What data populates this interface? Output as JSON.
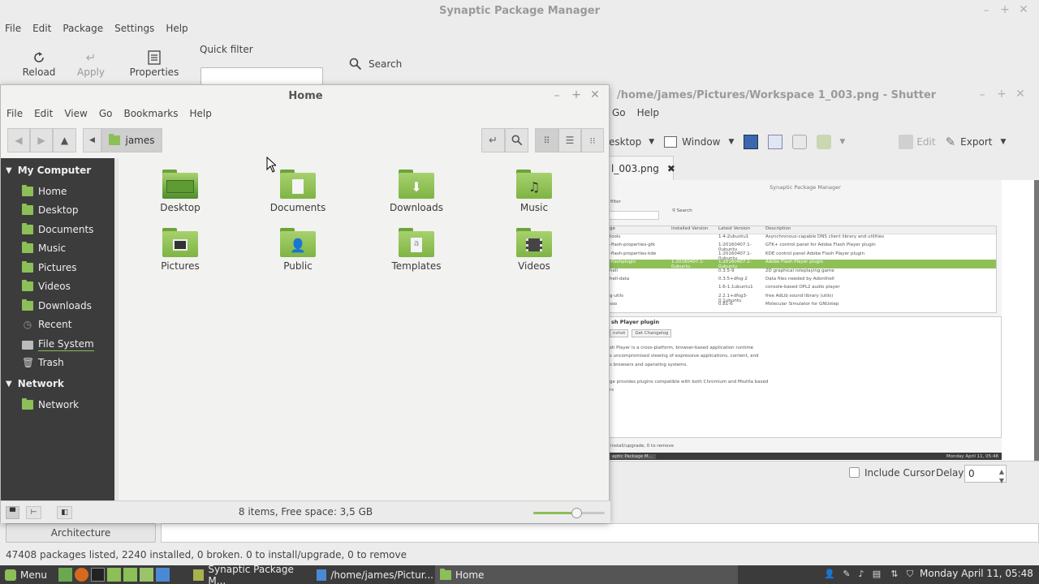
{
  "synaptic": {
    "title": "Synaptic Package Manager",
    "menu": [
      "File",
      "Edit",
      "Package",
      "Settings",
      "Help"
    ],
    "toolbar": {
      "reload": "Reload",
      "apply": "Apply",
      "properties": "Properties",
      "quick_filter": "Quick filter",
      "search": "Search"
    },
    "architecture_button": "Architecture",
    "status": "47408 packages listed, 2240 installed, 0 broken. 0 to install/upgrade, 0 to remove"
  },
  "shutter": {
    "title": "/home/james/Pictures/Workspace 1_003.png - Shutter",
    "menu": [
      "Go",
      "Help"
    ],
    "toolbar": {
      "desktop": "esktop",
      "window": "Window",
      "edit": "Edit",
      "export": "Export"
    },
    "tab_label": "l_003.png",
    "include_cursor": "Include Cursor",
    "delay_label": "Delay:",
    "delay_value": "0",
    "thumb": {
      "title": "Synaptic Package Manager",
      "filter": "filter",
      "search": "Search",
      "columns": [
        "ge",
        "Installed Version",
        "Latest Version",
        "Description"
      ],
      "rows": [
        [
          "tools",
          "",
          "1.4-2ubuntu1",
          "Asynchronous-capable DNS client library and utilities"
        ],
        [
          "-flash-properties-gtk",
          "",
          "1:20160407.1-0ubuntu",
          "GTK+ control panel for Adobe Flash Player plugin"
        ],
        [
          "-flash-properties-kde",
          "",
          "1:20160407.1-0ubuntu",
          "KDE control panel Adobe Flash Player plugin"
        ],
        [
          "-flashplugin",
          "1:20160407.1-0ubuntu",
          "1:20160407.1-0ubuntu",
          "Adobe Flash Player plugin"
        ],
        [
          "hell",
          "",
          "0.3.5-9",
          "2D graphical roleplaying game"
        ],
        [
          "hell-data",
          "",
          "0.3.5+dfsg-2",
          "Data files needed by Adonthell"
        ],
        [
          "",
          "",
          "1.6-1.1ubuntu1",
          "console-based OPL2 audio player"
        ],
        [
          "g-utils",
          "",
          "2.2.1+dfsg3-0.1ubuntu",
          "free AdLib sound library (utils)"
        ],
        [
          "sso",
          "",
          "0.81-6",
          "Molecular Simulator for GNUstep"
        ]
      ],
      "detail_title": "sh Player plugin",
      "detail_buttons": [
        "nshot",
        "Get Changelog"
      ],
      "detail_lines": [
        "sh Player is a cross-platform, browser-based application runtime",
        "s uncompromised viewing of expressive applications, content, and",
        "s browsers and operating systems.",
        "",
        "ge provides plugins compatible with both Chromium and Mozilla based",
        "rs"
      ],
      "status": "install/upgrade, 0 to remove",
      "taskbar_item": "aptic Package M...",
      "clock": "Monday April 11, 05:48"
    }
  },
  "nemo": {
    "title": "Home",
    "menu": [
      "File",
      "Edit",
      "View",
      "Go",
      "Bookmarks",
      "Help"
    ],
    "path_button": "james",
    "sidebar": {
      "my_computer": "My Computer",
      "items": [
        "Home",
        "Desktop",
        "Documents",
        "Music",
        "Pictures",
        "Videos",
        "Downloads",
        "Recent",
        "File System",
        "Trash"
      ],
      "network_header": "Network",
      "network_items": [
        "Network"
      ]
    },
    "folders": [
      "Desktop",
      "Documents",
      "Downloads",
      "Music",
      "Pictures",
      "Public",
      "Templates",
      "Videos"
    ],
    "status": "8 items, Free space: 3,5 GB",
    "zoom_level": 0.6
  },
  "taskbar": {
    "menu": "Menu",
    "tasks": [
      "Synaptic Package M...",
      "/home/james/Pictur...",
      "Home"
    ],
    "clock": "Monday April 11, 05:48"
  },
  "colors": {
    "accent_green": "#8cbf57",
    "sidebar_bg": "#3c3c3c",
    "taskbar_bg": "#3b3b3b",
    "selection_green": "#8fc058"
  }
}
